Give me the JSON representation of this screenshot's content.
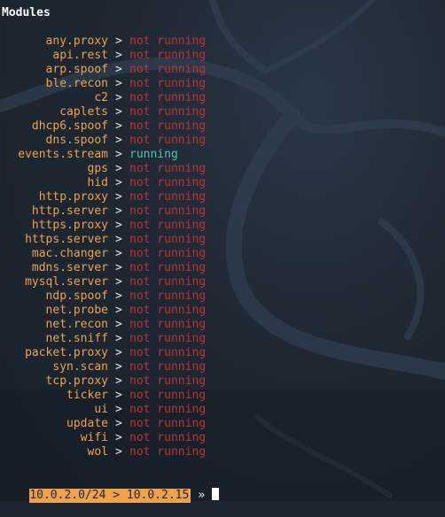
{
  "title": "Modules",
  "modules": [
    {
      "name": "any.proxy",
      "status": "not running"
    },
    {
      "name": "api.rest",
      "status": "not running"
    },
    {
      "name": "arp.spoof",
      "status": "not running"
    },
    {
      "name": "ble.recon",
      "status": "not running"
    },
    {
      "name": "c2",
      "status": "not running"
    },
    {
      "name": "caplets",
      "status": "not running"
    },
    {
      "name": "dhcp6.spoof",
      "status": "not running"
    },
    {
      "name": "dns.spoof",
      "status": "not running"
    },
    {
      "name": "events.stream",
      "status": "running"
    },
    {
      "name": "gps",
      "status": "not running"
    },
    {
      "name": "hid",
      "status": "not running"
    },
    {
      "name": "http.proxy",
      "status": "not running"
    },
    {
      "name": "http.server",
      "status": "not running"
    },
    {
      "name": "https.proxy",
      "status": "not running"
    },
    {
      "name": "https.server",
      "status": "not running"
    },
    {
      "name": "mac.changer",
      "status": "not running"
    },
    {
      "name": "mdns.server",
      "status": "not running"
    },
    {
      "name": "mysql.server",
      "status": "not running"
    },
    {
      "name": "ndp.spoof",
      "status": "not running"
    },
    {
      "name": "net.probe",
      "status": "not running"
    },
    {
      "name": "net.recon",
      "status": "not running"
    },
    {
      "name": "net.sniff",
      "status": "not running"
    },
    {
      "name": "packet.proxy",
      "status": "not running"
    },
    {
      "name": "syn.scan",
      "status": "not running"
    },
    {
      "name": "tcp.proxy",
      "status": "not running"
    },
    {
      "name": "ticker",
      "status": "not running"
    },
    {
      "name": "ui",
      "status": "not running"
    },
    {
      "name": "update",
      "status": "not running"
    },
    {
      "name": "wifi",
      "status": "not running"
    },
    {
      "name": "wol",
      "status": "not running"
    }
  ],
  "separator": ">",
  "prompt": {
    "context": "10.0.2.0/24 > 10.0.2.15",
    "arrow": "»"
  },
  "colors": {
    "background": "#1c2530",
    "module_name": "#f0a24b",
    "not_running": "#c0313a",
    "running": "#4ec2b0",
    "prompt_bg": "#f0a24b"
  },
  "icons": {
    "background_art": "kali-dragon-icon"
  }
}
